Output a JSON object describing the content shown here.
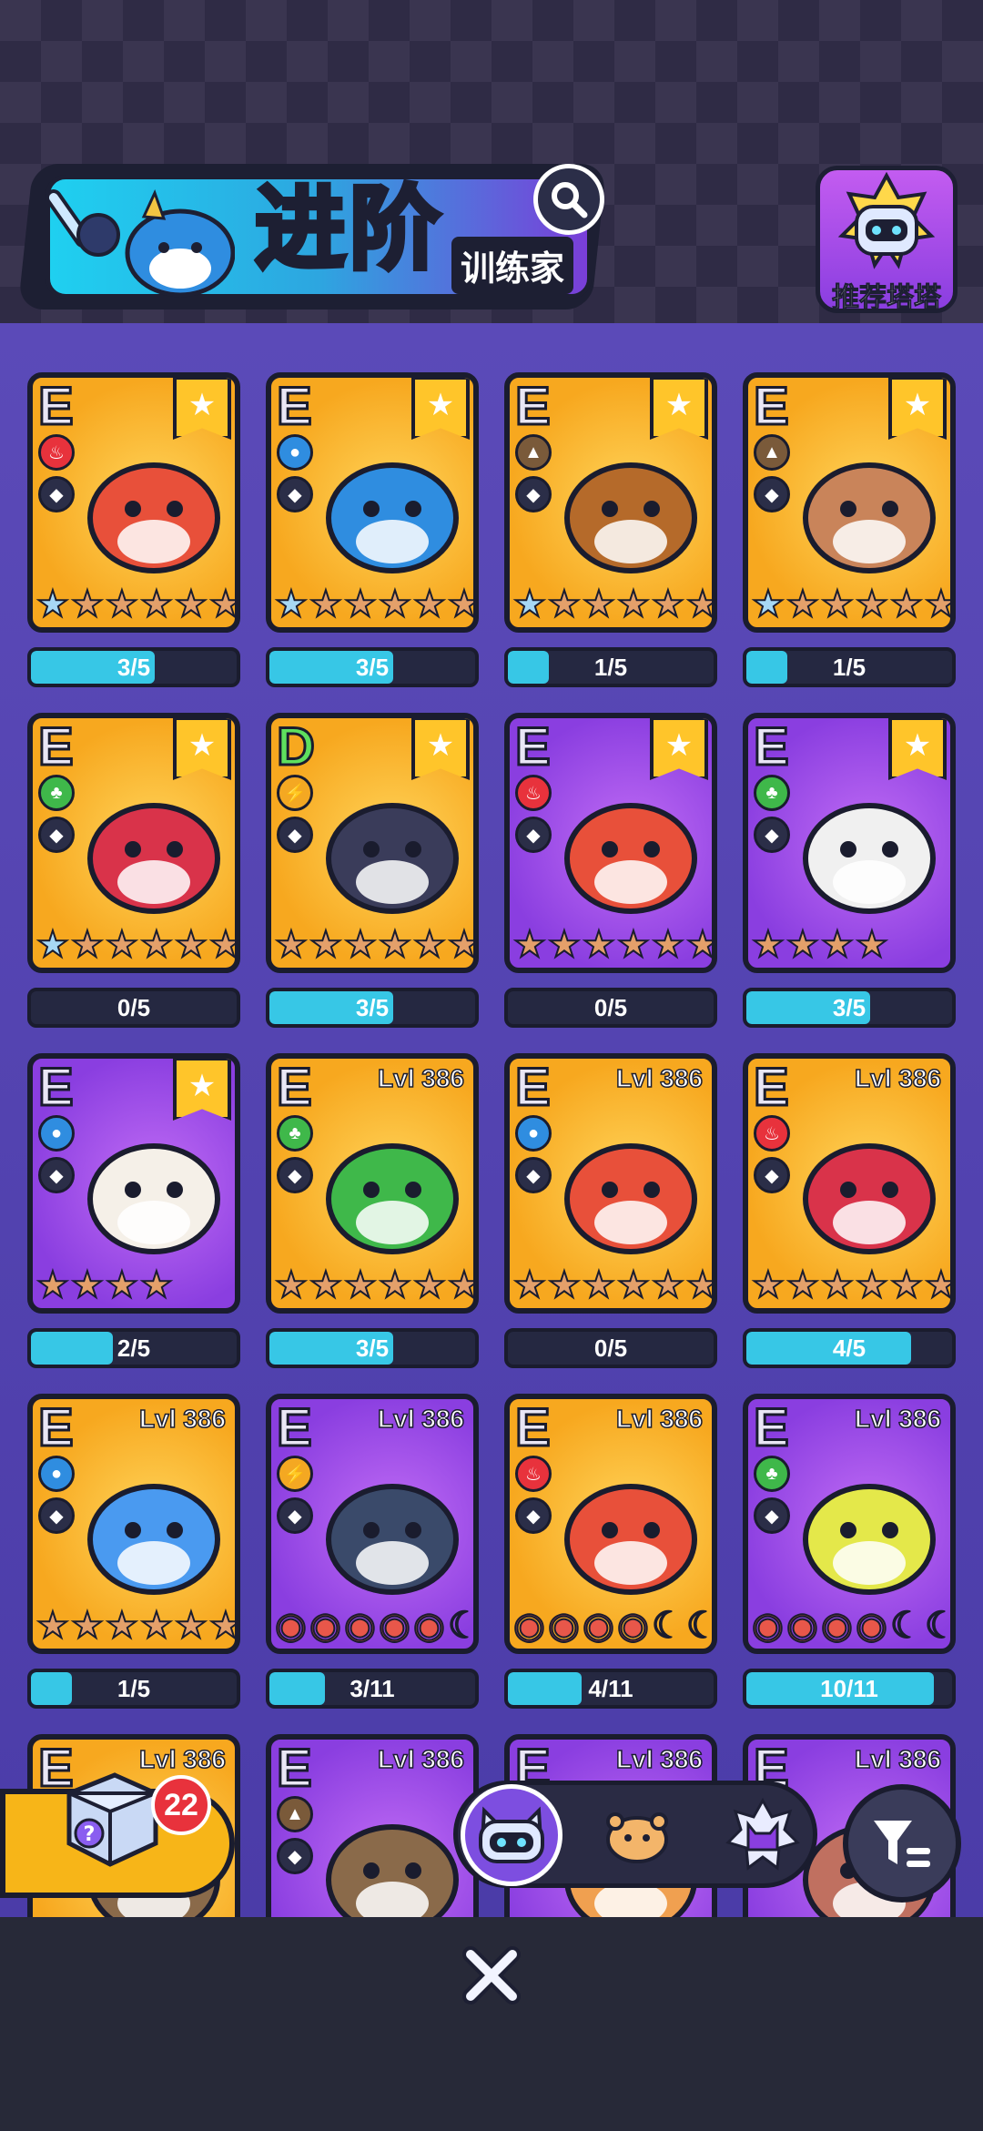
{
  "header": {
    "title": "进阶",
    "subtitle": "训练家",
    "recommend_label": "推荐塔塔"
  },
  "colors": {
    "accent_cyan": "#37c7e6",
    "gold_card": "#f7a81f",
    "purple_card": "#8a3ee0",
    "dark_outline": "#1a1c2e"
  },
  "cards": [
    {
      "grade": "E",
      "bg": "gold",
      "elem": "fire",
      "ribbon": true,
      "lvl": "",
      "stars": [
        "blue",
        "n",
        "n",
        "n",
        "n",
        "n"
      ],
      "progress": "3/5",
      "fill": 0.6
    },
    {
      "grade": "E",
      "bg": "gold",
      "elem": "water",
      "ribbon": true,
      "lvl": "",
      "stars": [
        "blue",
        "n",
        "n",
        "n",
        "n",
        "n"
      ],
      "progress": "3/5",
      "fill": 0.6
    },
    {
      "grade": "E",
      "bg": "gold",
      "elem": "earth",
      "ribbon": true,
      "lvl": "",
      "stars": [
        "blue",
        "n",
        "n",
        "n",
        "n",
        "n"
      ],
      "progress": "1/5",
      "fill": 0.2
    },
    {
      "grade": "E",
      "bg": "gold",
      "elem": "earth",
      "ribbon": true,
      "lvl": "",
      "stars": [
        "blue",
        "n",
        "n",
        "n",
        "n",
        "n"
      ],
      "progress": "1/5",
      "fill": 0.2
    },
    {
      "grade": "E",
      "bg": "gold",
      "elem": "leaf",
      "ribbon": true,
      "lvl": "",
      "stars": [
        "blue",
        "n",
        "n",
        "n",
        "n",
        "n"
      ],
      "progress": "0/5",
      "fill": 0
    },
    {
      "grade": "D",
      "bg": "gold",
      "elem": "lightning",
      "ribbon": true,
      "lvl": "",
      "stars": [
        "n",
        "n",
        "n",
        "n",
        "n",
        "n"
      ],
      "progress": "3/5",
      "fill": 0.6
    },
    {
      "grade": "E",
      "bg": "purple",
      "elem": "fire",
      "ribbon": true,
      "lvl": "",
      "stars": [
        "n",
        "n",
        "n",
        "n",
        "n",
        "n"
      ],
      "progress": "0/5",
      "fill": 0
    },
    {
      "grade": "E",
      "bg": "purple",
      "elem": "leaf",
      "ribbon": true,
      "lvl": "",
      "stars": [
        "n",
        "n",
        "n",
        "n"
      ],
      "progress": "3/5",
      "fill": 0.6
    },
    {
      "grade": "E",
      "bg": "purple",
      "elem": "water",
      "ribbon": true,
      "lvl": "",
      "stars": [
        "n",
        "n",
        "n",
        "n"
      ],
      "progress": "2/5",
      "fill": 0.4
    },
    {
      "grade": "E",
      "bg": "gold",
      "elem": "leaf",
      "ribbon": false,
      "lvl": "Lvl 386",
      "stars": [
        "n",
        "n",
        "n",
        "n",
        "n",
        "n"
      ],
      "progress": "3/5",
      "fill": 0.6
    },
    {
      "grade": "E",
      "bg": "gold",
      "elem": "water",
      "ribbon": false,
      "lvl": "Lvl 386",
      "stars": [
        "n",
        "n",
        "n",
        "n",
        "n",
        "n"
      ],
      "progress": "0/5",
      "fill": 0
    },
    {
      "grade": "E",
      "bg": "gold",
      "elem": "fire",
      "ribbon": false,
      "lvl": "Lvl 386",
      "stars": [
        "n",
        "n",
        "n",
        "n",
        "n",
        "n"
      ],
      "progress": "4/5",
      "fill": 0.8
    },
    {
      "grade": "E",
      "bg": "gold",
      "elem": "water",
      "ribbon": false,
      "lvl": "Lvl 386",
      "stars": [
        "n",
        "n",
        "n",
        "n",
        "n",
        "n"
      ],
      "progress": "1/5",
      "fill": 0.2
    },
    {
      "grade": "E",
      "bg": "purple",
      "elem": "lightning",
      "ribbon": false,
      "lvl": "Lvl 386",
      "stars": [
        "red",
        "red",
        "red",
        "red",
        "red",
        "moon"
      ],
      "progress": "3/11",
      "fill": 0.27
    },
    {
      "grade": "E",
      "bg": "gold",
      "elem": "fire",
      "ribbon": false,
      "lvl": "Lvl 386",
      "stars": [
        "red",
        "red",
        "red",
        "red",
        "moon",
        "moon"
      ],
      "progress": "4/11",
      "fill": 0.36
    },
    {
      "grade": "E",
      "bg": "purple",
      "elem": "leaf",
      "ribbon": false,
      "lvl": "Lvl 386",
      "stars": [
        "red",
        "red",
        "red",
        "red",
        "moon",
        "moon"
      ],
      "progress": "10/11",
      "fill": 0.91
    },
    {
      "grade": "E",
      "bg": "gold",
      "elem": "earth",
      "ribbon": false,
      "lvl": "Lvl 386",
      "stars": [],
      "progress": "",
      "fill": 0
    },
    {
      "grade": "E",
      "bg": "purple",
      "elem": "earth",
      "ribbon": false,
      "lvl": "Lvl 386",
      "stars": [],
      "progress": "",
      "fill": 0
    },
    {
      "grade": "E",
      "bg": "purple",
      "elem": "fire",
      "ribbon": false,
      "lvl": "Lvl 386",
      "stars": [],
      "progress": "",
      "fill": 0
    },
    {
      "grade": "E",
      "bg": "purple",
      "elem": "water",
      "ribbon": false,
      "lvl": "Lvl 386",
      "stars": [],
      "progress": "",
      "fill": 0
    }
  ],
  "gift": {
    "count": "22"
  },
  "tabs": [
    {
      "icon": "cat-robot-icon",
      "active": true
    },
    {
      "icon": "hamster-icon",
      "active": false
    },
    {
      "icon": "purple-cat-icon",
      "active": false
    }
  ],
  "filter_icon": "filter-icon",
  "close_icon": "close-icon"
}
